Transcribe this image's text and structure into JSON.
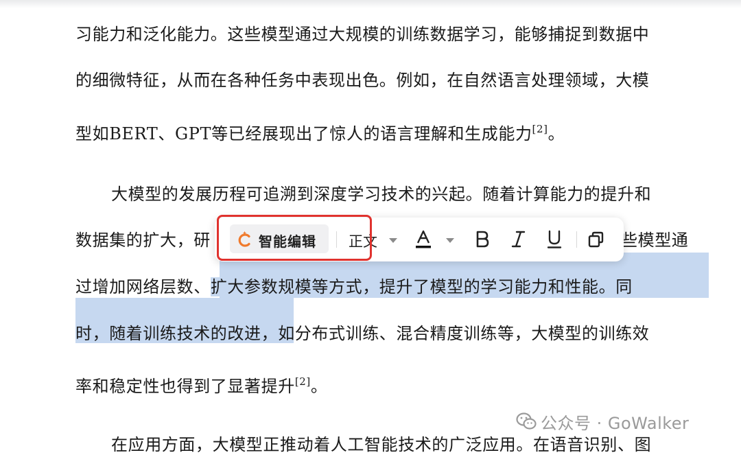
{
  "document": {
    "lines": [
      {
        "text": "习能力和泛化能力。这些模型通过大规模的训练数据学习，能够捕捉到数据中"
      },
      {
        "text": "的细微特征，从而在各种任务中表现出色。例如，在自然语言处理领域，大模"
      },
      {
        "text": "型如BERT、GPT等已经展现出了惊人的语言理解和生成能力",
        "ref": "[2]",
        "tail": "。"
      },
      {
        "text": "大模型的发展历程可追溯到深度学习技术的兴起。随着计算能力的提升和"
      },
      {
        "left": "数据集的扩大，研",
        "right": "些模型通"
      },
      {
        "plain": "过增加网络层数、",
        "selected": "扩大参数规模等方式，提升了模型的学习能力和性能。同"
      },
      {
        "selected": "时，随着训练技术的改进，",
        "plain": "如分布式训练、混合精度训练等，大模型的训练效"
      },
      {
        "text": "率和稳定性也得到了显著提升",
        "ref": "[2]",
        "tail": "。"
      },
      {
        "text": "在应用方面，大模型正推动着人工智能技术的广泛应用。在语音识别、图"
      }
    ]
  },
  "toolbar": {
    "smart_edit_label": "智能编辑",
    "smart_edit_icon": "brand-c-spark-icon",
    "style_label": "正文",
    "font_color_icon": "font-color-a-icon",
    "bold_icon": "bold-b-icon",
    "italic_icon": "italic-i-icon",
    "underline_icon": "underline-u-icon",
    "copy_icon": "copy-icon",
    "accent_color": "#f07a2c",
    "highlight_frame_color": "#e0322e"
  },
  "selection_color": "#c6d8f0",
  "watermark": {
    "text": "公众号 · GoWalker",
    "icon": "wechat-icon"
  }
}
